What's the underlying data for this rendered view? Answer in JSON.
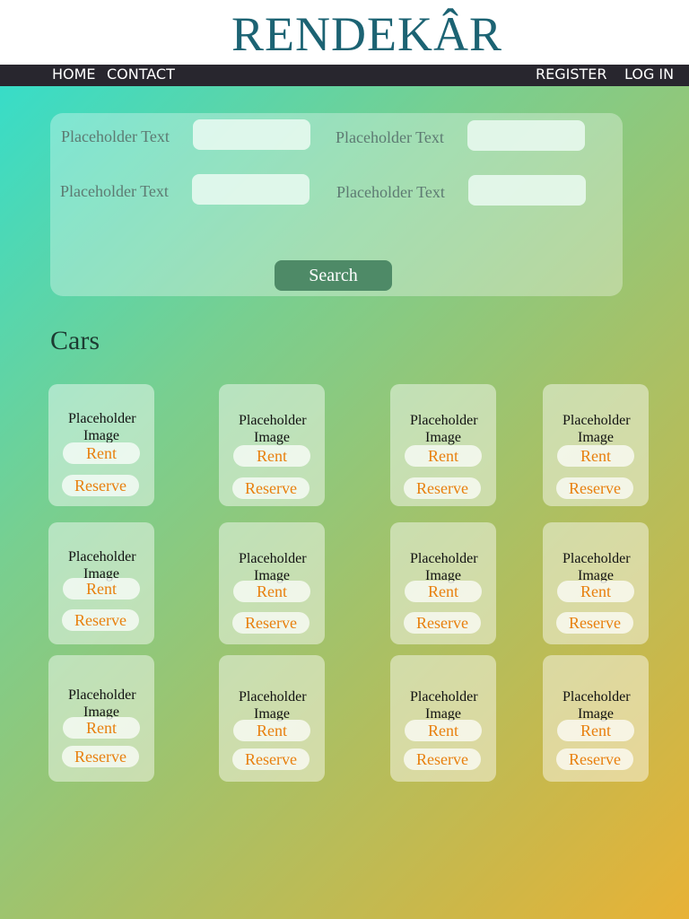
{
  "brand": {
    "logo_text": "RENDEKÂR",
    "logo_color": "#1c6373"
  },
  "nav": {
    "left": [
      "HOME",
      "CONTACT"
    ],
    "right": [
      "REGISTER",
      "LOG IN"
    ]
  },
  "search_form": {
    "fields": [
      {
        "label": "Placeholder Text",
        "value": ""
      },
      {
        "label": "Placeholder Text",
        "value": ""
      },
      {
        "label": "Placeholder Text",
        "value": ""
      },
      {
        "label": "Placeholder Text",
        "value": ""
      }
    ],
    "submit_label": "Search"
  },
  "cars": {
    "title": "Cars",
    "card": {
      "image_text": "Placeholder Image",
      "rent_label": "Rent",
      "reserve_label": "Reserve"
    }
  },
  "colors": {
    "accent": "#e8800f",
    "nav_bg": "#28262e",
    "search_button": "#4e8a67"
  }
}
